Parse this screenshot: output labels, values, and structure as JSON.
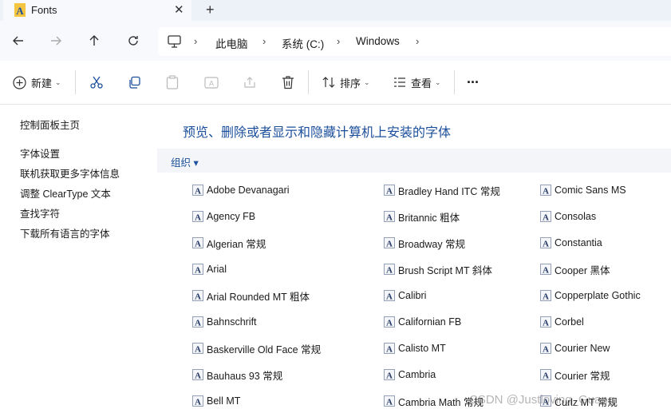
{
  "tab": {
    "title": "Fonts",
    "close": "✕",
    "new": "+"
  },
  "nav": {
    "back": "back",
    "forward": "forward",
    "up": "up",
    "refresh": "refresh",
    "breadcrumb": [
      "此电脑",
      "系统 (C:)",
      "Windows"
    ]
  },
  "toolbar": {
    "new_label": "新建",
    "sort_label": "排序",
    "view_label": "查看",
    "more": "···"
  },
  "sidebar": {
    "home": "控制面板主页",
    "links": [
      "字体设置",
      "联机获取更多字体信息",
      "调整 ClearType 文本",
      "查找字符",
      "下载所有语言的字体"
    ]
  },
  "main": {
    "heading": "预览、删除或者显示和隐藏计算机上安装的字体",
    "organize": "组织 ▾",
    "fonts": [
      [
        "Adobe Devanagari",
        "Agency FB",
        "Algerian 常规",
        "Arial",
        "Arial Rounded MT 粗体",
        "Bahnschrift",
        "Baskerville Old Face 常规",
        "Bauhaus 93 常规",
        "Bell MT"
      ],
      [
        "Bradley Hand ITC 常规",
        "Britannic 粗体",
        "Broadway 常规",
        "Brush Script MT 斜体",
        "Calibri",
        "Californian FB",
        "Calisto MT",
        "Cambria",
        "Cambria Math 常规"
      ],
      [
        "Comic Sans MS",
        "Consolas",
        "Constantia",
        "Cooper 黑体",
        "Copperplate Gothic",
        "Corbel",
        "Courier New",
        "Courier 常规",
        "Curlz MT 常规"
      ]
    ]
  },
  "watermark": "CSDN @Justloving_Guang",
  "colors": {
    "accent": "#1b4f9b",
    "tabbar": "#edf1f8",
    "navbar": "#f7f9fc"
  }
}
